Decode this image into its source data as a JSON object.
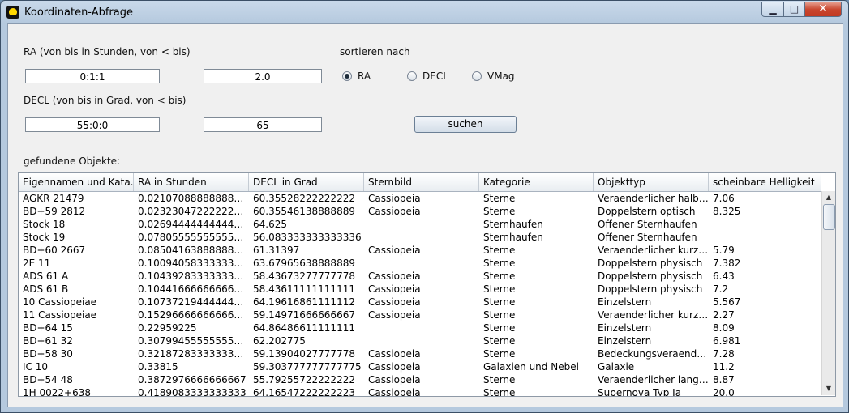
{
  "window": {
    "title": "Koordinaten-Abfrage",
    "close_glyph": "✕",
    "min_glyph": "▁",
    "max_glyph": "□"
  },
  "ra": {
    "label": "RA (von bis in Stunden, von < bis)",
    "from": "0:1:1",
    "to": "2.0"
  },
  "decl": {
    "label": "DECL (von bis in Grad, von < bis)",
    "from": "55:0:0",
    "to": "65"
  },
  "sort": {
    "label": "sortieren nach",
    "options": [
      {
        "label": "RA",
        "selected": true
      },
      {
        "label": "DECL",
        "selected": false
      },
      {
        "label": "VMag",
        "selected": false
      }
    ]
  },
  "search_label": "suchen",
  "results_label": "gefundene Objekte:",
  "table": {
    "columns": [
      "Eigennamen und Kata...",
      "RA in Stunden",
      "DECL in Grad",
      "Sternbild",
      "Kategorie",
      "Objekttyp",
      "scheinbare Helligkeit"
    ],
    "rows": [
      [
        "AGKR 21479",
        "0.02107088888888889",
        "60.35528222222222",
        "Cassiopeia",
        "Sterne",
        "Veraenderlicher halbr...",
        "7.06"
      ],
      [
        "BD+59 2812",
        "0.0232304722222222...",
        "60.35546138888889",
        "Cassiopeia",
        "Sterne",
        "Doppelstern optisch",
        "8.325"
      ],
      [
        "Stock 18",
        "0.0269444444444444...",
        "64.625",
        "",
        "Sternhaufen",
        "Offener Sternhaufen",
        ""
      ],
      [
        "Stock 19",
        "0.07805555555555556",
        "56.083333333333336",
        "",
        "Sternhaufen",
        "Offener Sternhaufen",
        ""
      ],
      [
        "BD+60 2667",
        "0.08504163888888888",
        "61.31397",
        "Cassiopeia",
        "Sterne",
        "Veraenderlicher kurzp...",
        "5.79"
      ],
      [
        "2E 11",
        "0.10094058333333333",
        "63.67965638888889",
        "",
        "Sterne",
        "Doppelstern physisch",
        "7.382"
      ],
      [
        "ADS 61 A",
        "0.10439283333333334",
        "58.43673277777778",
        "Cassiopeia",
        "Sterne",
        "Doppelstern physisch",
        "6.43"
      ],
      [
        "ADS 61 B",
        "0.10441666666666667",
        "58.43611111111111",
        "Cassiopeia",
        "Sterne",
        "Doppelstern physisch",
        "7.2"
      ],
      [
        "10 Cassiopeiae",
        "0.10737219444444444",
        "64.19616861111112",
        "Cassiopeia",
        "Sterne",
        "Einzelstern",
        "5.567"
      ],
      [
        "11 Cassiopeiae",
        "0.15296666666666667",
        "59.14971666666667",
        "Cassiopeia",
        "Sterne",
        "Veraenderlicher kurzp...",
        "2.27"
      ],
      [
        "BD+64 15",
        "0.22959225",
        "64.86486611111111",
        "",
        "Sterne",
        "Einzelstern",
        "8.09"
      ],
      [
        "BD+61 32",
        "0.30799455555555555",
        "62.202775",
        "",
        "Sterne",
        "Einzelstern",
        "6.981"
      ],
      [
        "BD+58 30",
        "0.32187283333333333",
        "59.13904027777778",
        "Cassiopeia",
        "Sterne",
        "Bedeckungsveraende...",
        "7.28"
      ],
      [
        "IC 10",
        "0.33815",
        "59.303777777777775",
        "Cassiopeia",
        "Galaxien und Nebel",
        "Galaxie",
        "11.2"
      ],
      [
        "BD+54 48",
        "0.3872976666666667",
        "55.79255722222222",
        "Cassiopeia",
        "Sterne",
        "Veraenderlicher langp...",
        "8.87"
      ],
      [
        "1H 0022+638",
        "0.4189083333333333",
        "64.16547222222223",
        "Cassiopeia",
        "Sterne",
        "Supernova Typ Ia",
        "20.0"
      ]
    ]
  },
  "scroll": {
    "up_glyph": "▲",
    "down_glyph": "▼"
  }
}
